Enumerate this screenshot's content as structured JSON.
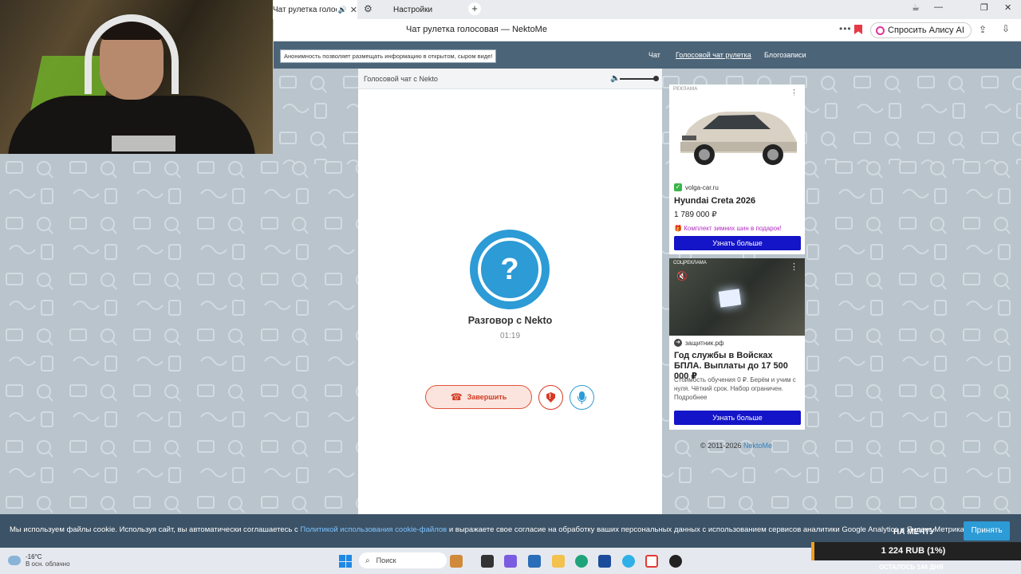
{
  "browser": {
    "active_tab": "Чат рулетка голосовая — NektoMe",
    "second_tab": "Настройки",
    "page_title": "Чат рулетка голосовая — NektoMe",
    "alice_label": "Спросить Алису AI"
  },
  "site": {
    "notice": "Анонимность позволяет размещать информацию в открытом, сыром виде!",
    "nav": [
      "Чат",
      "Голосовой чат рулетка",
      "Блогозаписи"
    ]
  },
  "chat": {
    "header_title": "Голосовой чат с Nekto",
    "avatar_glyph": "?",
    "conversation_title": "Разговор с Nekto",
    "timer": "01:19",
    "end_label": "Завершить"
  },
  "ads": [
    {
      "label": "РЕКЛАМА",
      "site": "volga-car.ru",
      "title": "Hyundai Creta 2026",
      "price": "1 789 000 ₽",
      "gift": "Комплект зимних шин в подарок!",
      "button": "Узнать больше"
    },
    {
      "label": "СОЦРЕКЛАМА",
      "site": "защитник.рф",
      "title": "Год службы в Войсках БПЛА. Выплаты до 17 500 000 ₽",
      "text": "Стоимость обучения 0 ₽. Берём и учим с нуля. Чёткий срок. Набор ограничен. Подробнее",
      "button": "Узнать больше"
    }
  ],
  "footer": {
    "copyright": "© 2011-2026 ",
    "brand": "NektoMe"
  },
  "cookie": {
    "text_before": "Мы используем файлы cookie. Используя сайт, вы автоматически соглашаетесь с ",
    "link": "Политикой использования cookie-файлов",
    "text_after": " и выражаете свое согласие на обработку ваших персональных данных с использованием сервисов аналитики Google Analytics и Яндекс.Метрика.",
    "accept": "Принять"
  },
  "donation": {
    "title": "НА МЕЧТУ",
    "amount": "1 224 RUB (1%)",
    "progress_percent": 1,
    "days_left": "ОСТАЛОСЬ 144 ДНЯ"
  },
  "taskbar": {
    "temperature": "-16°C",
    "weather": "В осн. облачно",
    "search_placeholder": "Поиск"
  },
  "colors": {
    "accent": "#2c9bd6",
    "end_call": "#d23b23",
    "ad_button": "#1414c8",
    "header": "#4c6478"
  }
}
